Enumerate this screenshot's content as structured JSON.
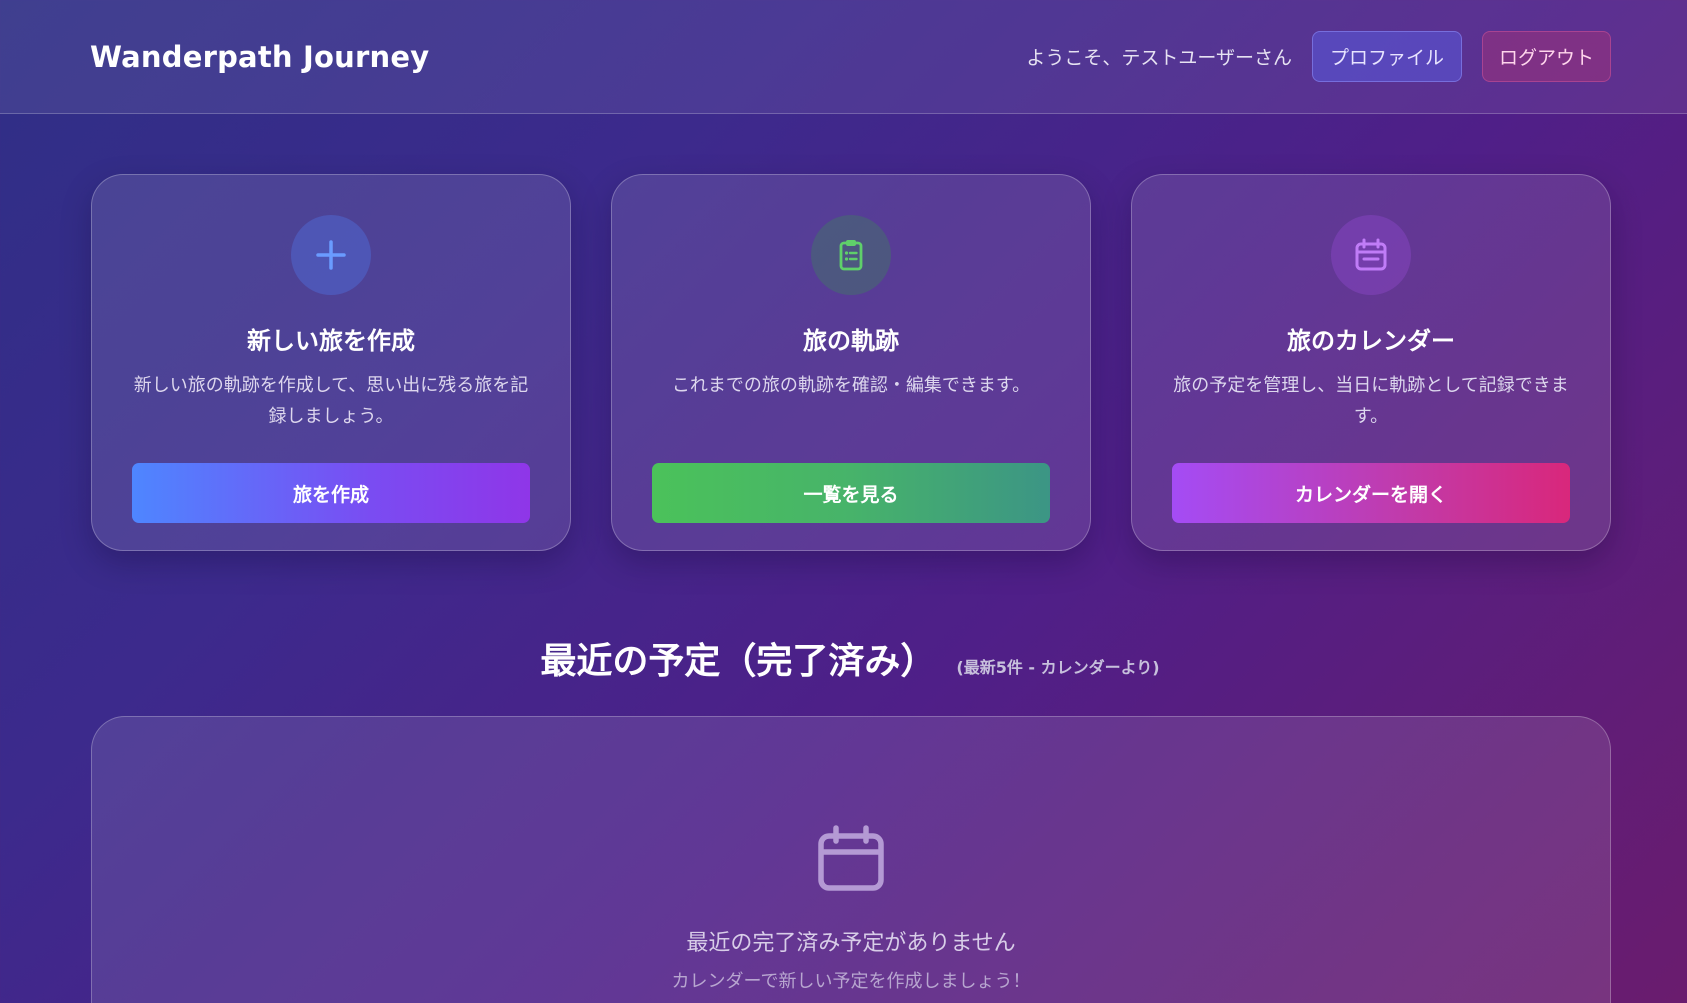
{
  "header": {
    "brand": "Wanderpath Journey",
    "welcome": "ようこそ、テストユーザーさん",
    "profile_label": "プロファイル",
    "logout_label": "ログアウト"
  },
  "cards": [
    {
      "icon": "plus-icon",
      "title": "新しい旅を作成",
      "description": "新しい旅の軌跡を作成して、思い出に残る旅を記録しましょう。",
      "button": "旅を作成"
    },
    {
      "icon": "clipboard-list-icon",
      "title": "旅の軌跡",
      "description": "これまでの旅の軌跡を確認・編集できます。",
      "button": "一覧を見る"
    },
    {
      "icon": "calendar-icon",
      "title": "旅のカレンダー",
      "description": "旅の予定を管理し、当日に軌跡として記録できます。",
      "button": "カレンダーを開く"
    }
  ],
  "recent": {
    "title": "最近の予定（完了済み）",
    "subtitle": "(最新5件 - カレンダーより)",
    "empty_icon": "calendar-icon",
    "empty_title": "最近の完了済み予定がありません",
    "empty_subtitle": "カレンダーで新しい予定を作成しましょう！"
  },
  "colors": {
    "accent_blue": "#4e86ff",
    "accent_green": "#4bc25a",
    "accent_pink": "#d9277b",
    "icon_blue": "#6a9bff",
    "icon_green": "#5fd06a",
    "icon_purple": "#c07cf7"
  }
}
